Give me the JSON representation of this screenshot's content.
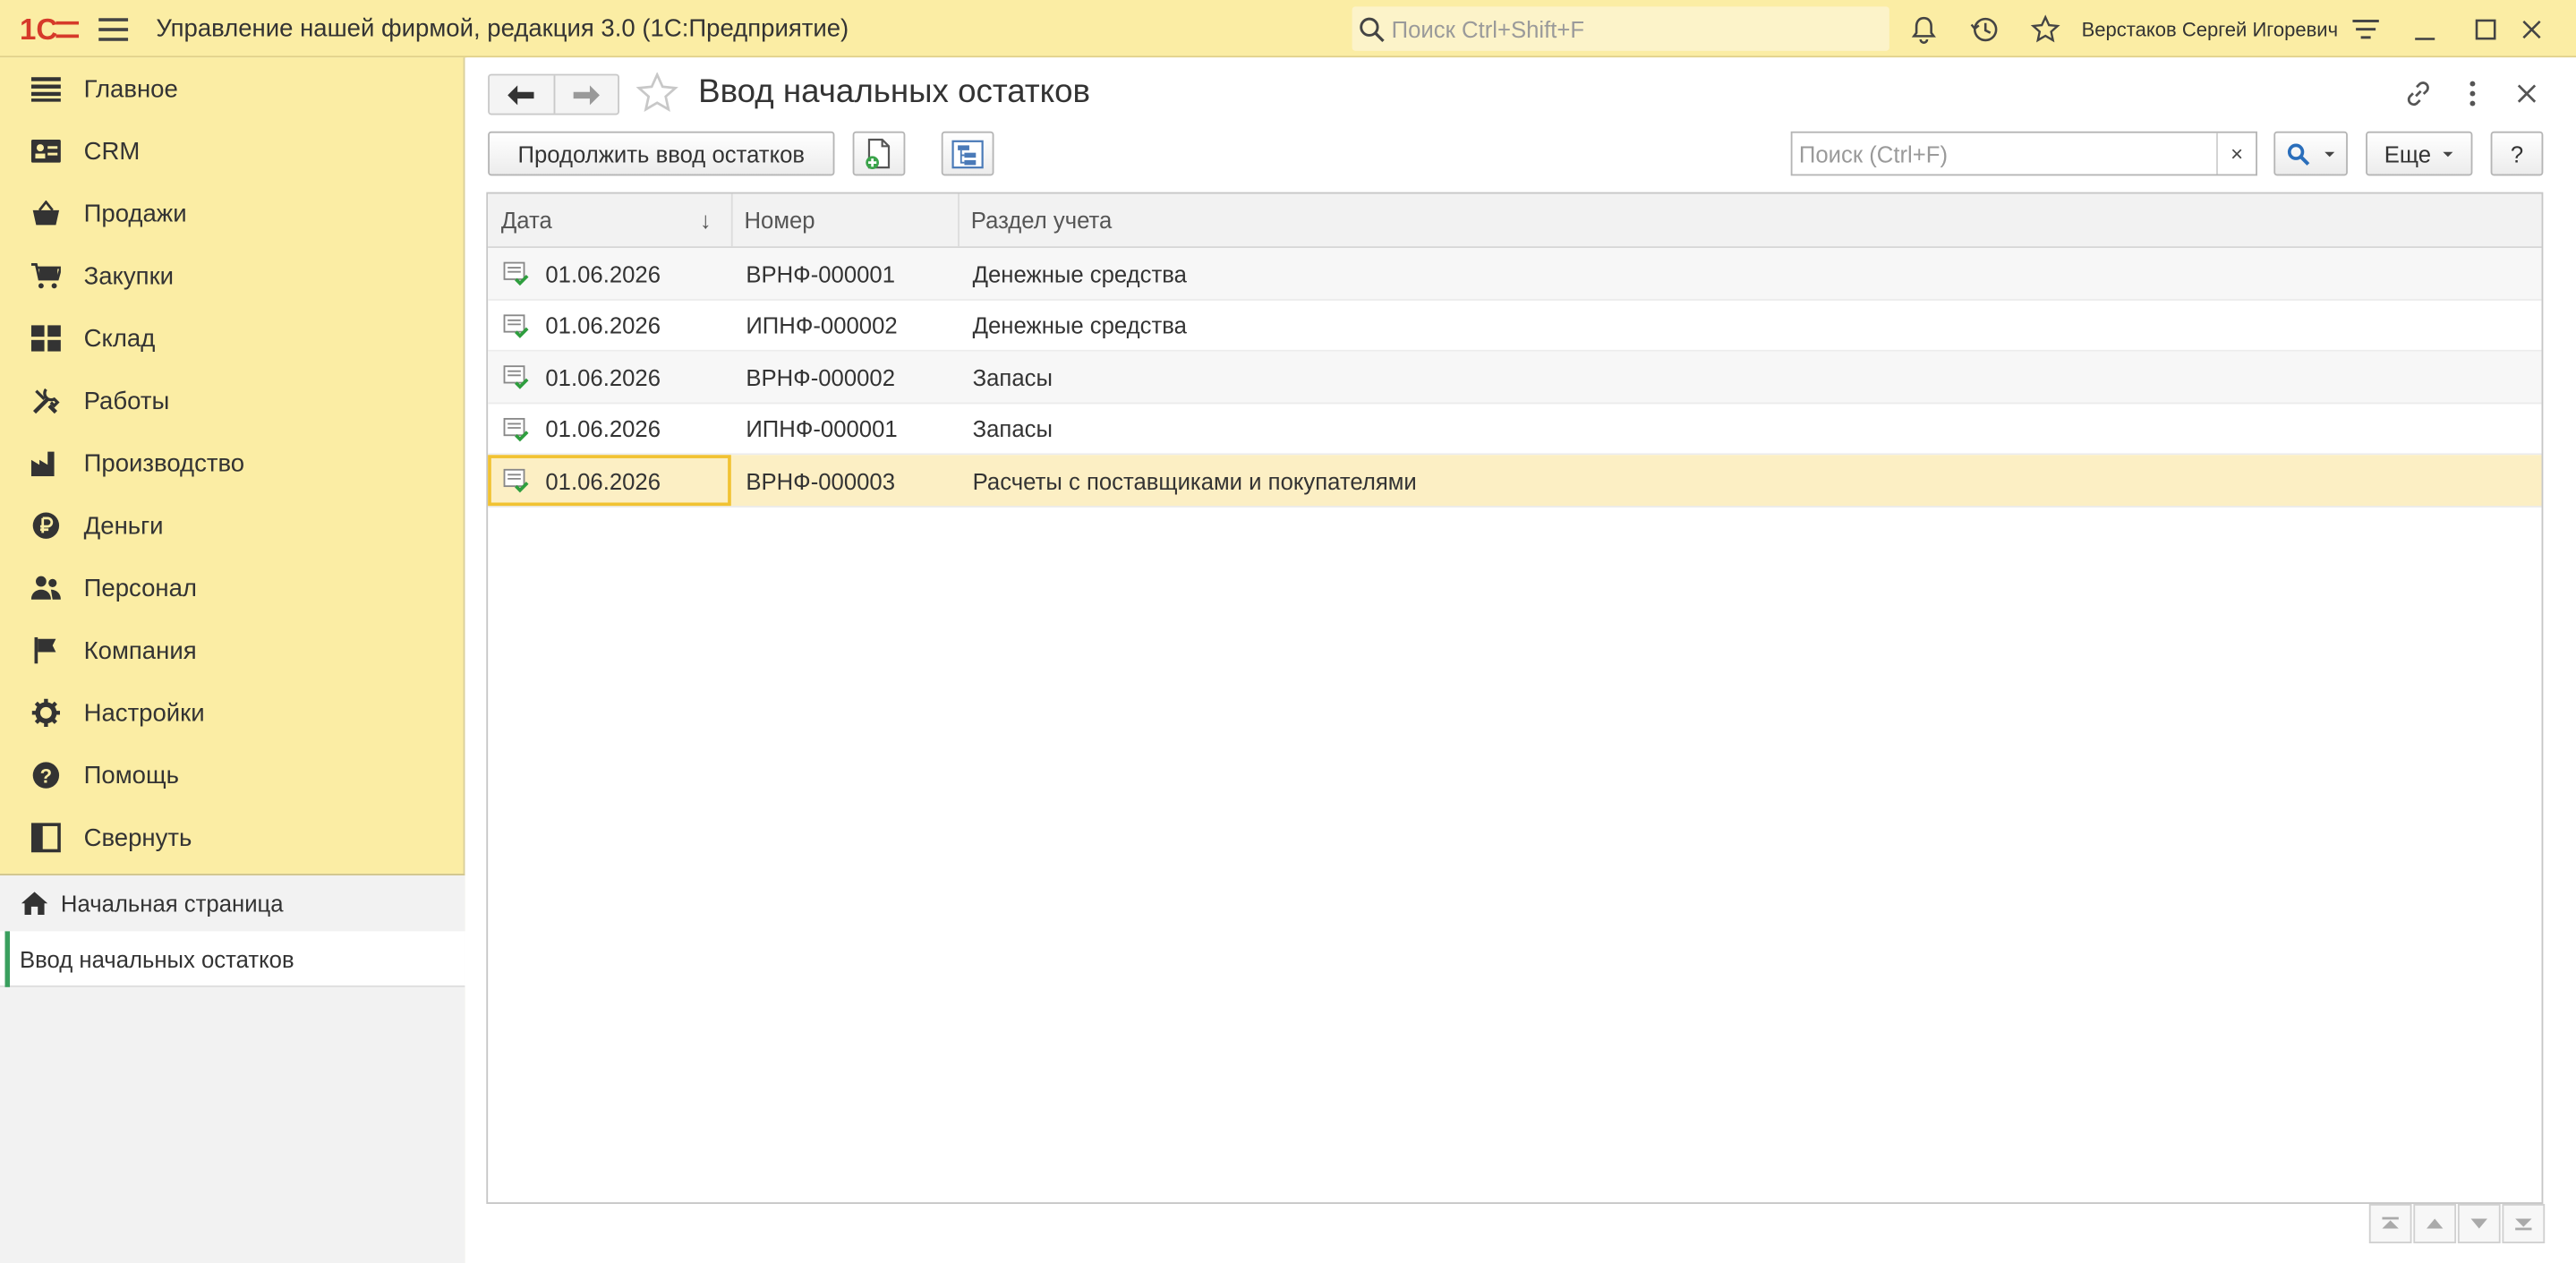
{
  "titlebar": {
    "app_title": "Управление нашей фирмой, редакция 3.0  (1С:Предприятие)",
    "search_placeholder": "Поиск Ctrl+Shift+F",
    "user": "Верстаков Сергей Игоревич",
    "brand_color": "#d63a2a",
    "bg_color": "#fbeda4"
  },
  "sidebar": {
    "items": [
      {
        "label": "Главное",
        "icon": "list-icon"
      },
      {
        "label": "CRM",
        "icon": "contacts-icon"
      },
      {
        "label": "Продажи",
        "icon": "basket-icon"
      },
      {
        "label": "Закупки",
        "icon": "cart-icon"
      },
      {
        "label": "Склад",
        "icon": "warehouse-icon"
      },
      {
        "label": "Работы",
        "icon": "tools-icon"
      },
      {
        "label": "Производство",
        "icon": "factory-icon"
      },
      {
        "label": "Деньги",
        "icon": "ruble-icon"
      },
      {
        "label": "Персонал",
        "icon": "people-icon"
      },
      {
        "label": "Компания",
        "icon": "flag-icon"
      },
      {
        "label": "Настройки",
        "icon": "gear-icon"
      },
      {
        "label": "Помощь",
        "icon": "help-icon"
      },
      {
        "label": "Свернуть",
        "icon": "collapse-icon"
      }
    ],
    "open_pages": {
      "home": "Начальная страница",
      "active": "Ввод начальных остатков"
    }
  },
  "main": {
    "title": "Ввод начальных остатков",
    "continue_button": "Продолжить ввод остатков",
    "search_placeholder": "Поиск (Ctrl+F)",
    "clear_label": "×",
    "more_button": "Еще",
    "help_button": "?",
    "columns": [
      "Дата",
      "Номер",
      "Раздел учета"
    ],
    "sort_indicator": "↓",
    "rows": [
      {
        "date": "01.06.2026",
        "number": "ВРНФ-000001",
        "section": "Денежные средства"
      },
      {
        "date": "01.06.2026",
        "number": "ИПНФ-000002",
        "section": "Денежные средства"
      },
      {
        "date": "01.06.2026",
        "number": "ВРНФ-000002",
        "section": "Запасы"
      },
      {
        "date": "01.06.2026",
        "number": "ИПНФ-000001",
        "section": "Запасы"
      },
      {
        "date": "01.06.2026",
        "number": "ВРНФ-000003",
        "section": "Расчеты с поставщиками и покупателями"
      }
    ],
    "selected_row": 4
  }
}
